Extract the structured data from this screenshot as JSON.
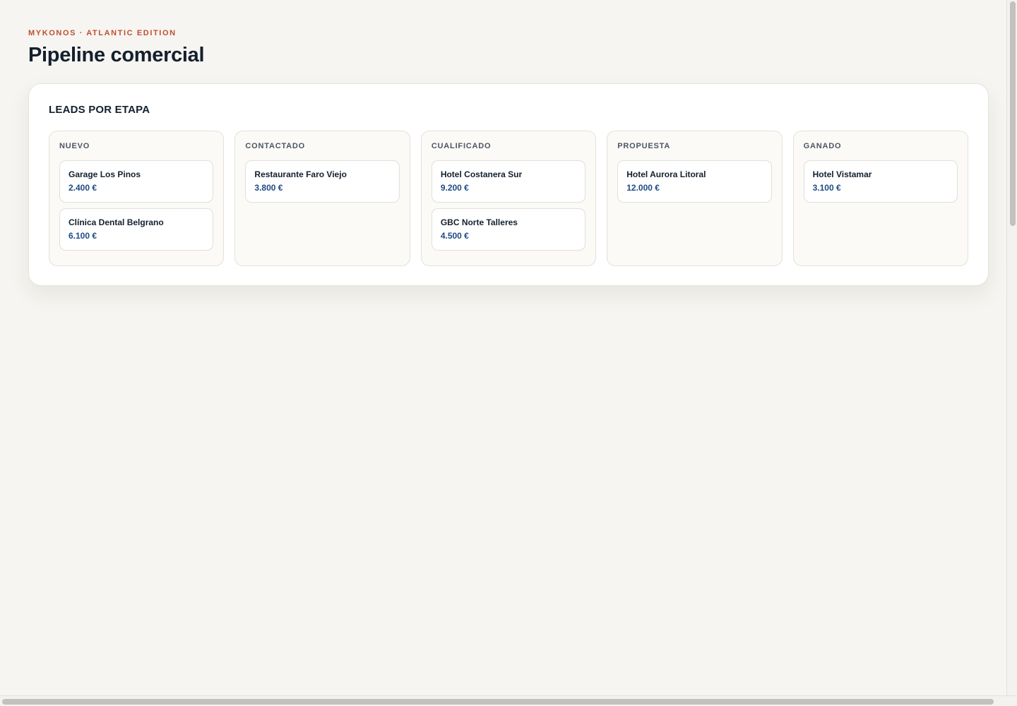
{
  "header": {
    "eyebrow": "MYKONOS · ATLANTIC EDITION",
    "title": "Pipeline comercial"
  },
  "board": {
    "title": "LEADS POR ETAPA",
    "columns": [
      {
        "title": "NUEVO",
        "leads": [
          {
            "name": "Garage Los Pinos",
            "value": "2.400 €"
          },
          {
            "name": "Clínica Dental Belgrano",
            "value": "6.100 €"
          }
        ]
      },
      {
        "title": "CONTACTADO",
        "leads": [
          {
            "name": "Restaurante Faro Viejo",
            "value": "3.800 €"
          }
        ]
      },
      {
        "title": "CUALIFICADO",
        "leads": [
          {
            "name": "Hotel Costanera Sur",
            "value": "9.200 €"
          },
          {
            "name": "GBC Norte Talleres",
            "value": "4.500 €"
          }
        ]
      },
      {
        "title": "PROPUESTA",
        "leads": [
          {
            "name": "Hotel Aurora Litoral",
            "value": "12.000 €"
          }
        ]
      },
      {
        "title": "GANADO",
        "leads": [
          {
            "name": "Hotel Vistamar",
            "value": "3.100 €"
          }
        ]
      }
    ]
  },
  "colors": {
    "background": "#f6f5f1",
    "accent": "#c04f30",
    "value": "#1f4a85",
    "text": "#13202e"
  }
}
